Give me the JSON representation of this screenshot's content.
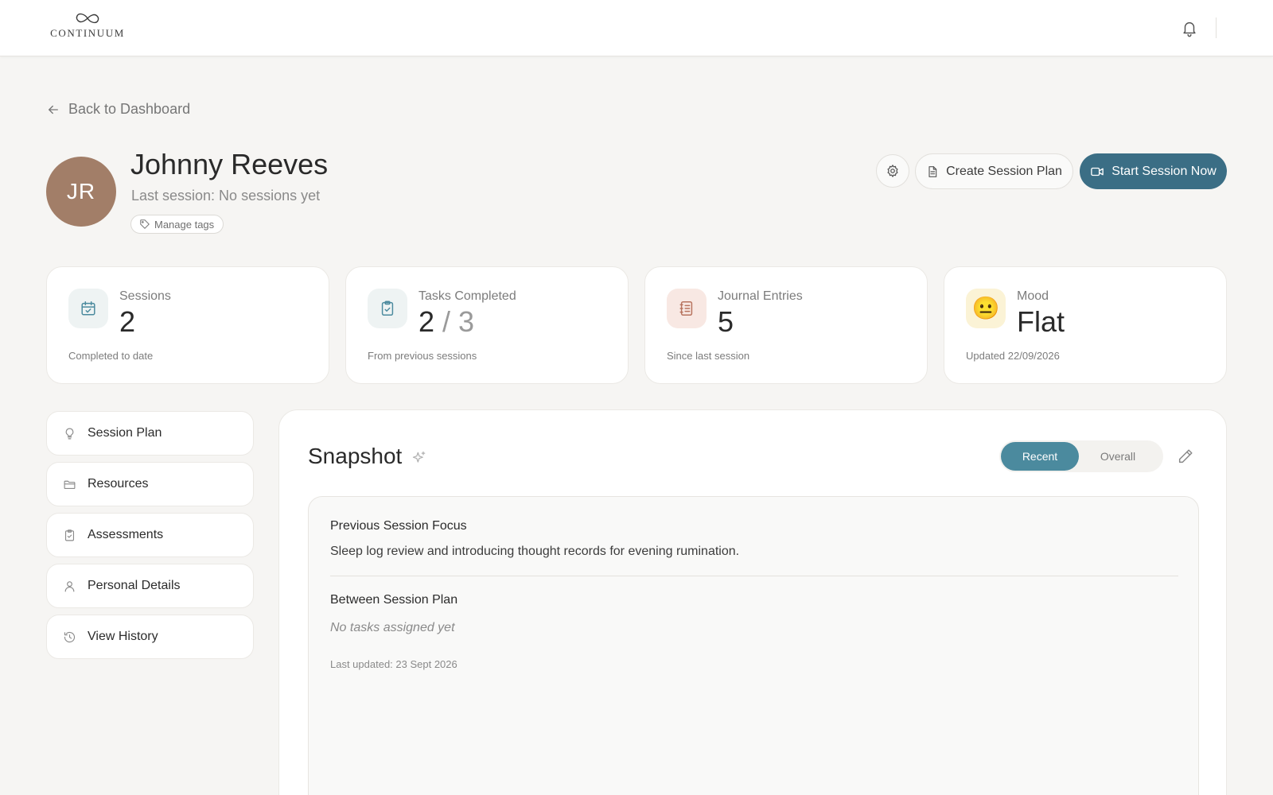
{
  "header": {
    "logo_text": "CONTINUUM"
  },
  "back_label": "Back to Dashboard",
  "client": {
    "initials": "JR",
    "name": "Johnny Reeves",
    "last_session": "Last session: No sessions yet",
    "tags_label": "Manage tags"
  },
  "actions": {
    "create_plan_label": "Create Session Plan",
    "start_session_label": "Start Session Now"
  },
  "stats": [
    {
      "label": "Sessions",
      "value": "2",
      "sub": "Completed to date",
      "icon": "calendar-check-icon"
    },
    {
      "label": "Tasks Completed",
      "value": "2",
      "value_total": "/ 3",
      "sub": "From previous sessions",
      "icon": "clipboard-check-icon"
    },
    {
      "label": "Journal Entries",
      "value": "5",
      "sub": "Since last session",
      "icon": "notebook-icon"
    },
    {
      "label": "Mood",
      "value": "Flat",
      "sub": "Updated 22/09/2026",
      "icon": "neutral-face-emoji",
      "emoji": "😐"
    }
  ],
  "sidebar": {
    "items": [
      {
        "label": "Session Plan",
        "icon": "lightbulb-icon"
      },
      {
        "label": "Resources",
        "icon": "folder-icon"
      },
      {
        "label": "Assessments",
        "icon": "clipboard-icon"
      },
      {
        "label": "Personal Details",
        "icon": "user-icon"
      },
      {
        "label": "View History",
        "icon": "history-icon"
      }
    ]
  },
  "snapshot": {
    "title": "Snapshot",
    "toggle": {
      "recent": "Recent",
      "overall": "Overall",
      "selected": "Recent"
    },
    "previous_focus_heading": "Previous Session Focus",
    "previous_focus_text": "Sleep log review and introducing thought records for evening rumination.",
    "plan_heading": "Between Session Plan",
    "plan_text": "No tasks assigned yet",
    "last_updated": "Last updated: 23 Sept 2026"
  },
  "colors": {
    "primary": "#3b6e85",
    "toggle_active": "#4b8a9e",
    "avatar": "#a27e68",
    "background": "#f6f5f3"
  }
}
